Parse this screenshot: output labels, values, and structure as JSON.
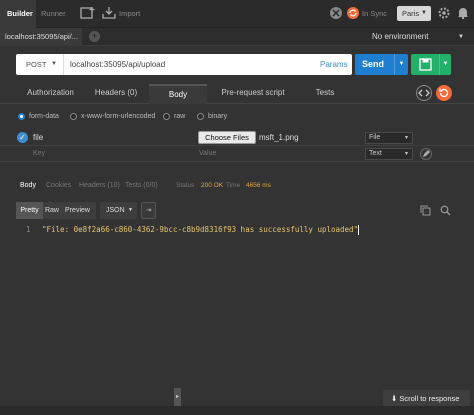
{
  "app": {
    "modes": [
      "Builder",
      "Runner"
    ],
    "import_label": "Import",
    "sync_label": "In Sync",
    "user_label": "Paris"
  },
  "tabs": {
    "request_tab": "localhost:35095/api/...",
    "environment": "No environment"
  },
  "request": {
    "method": "POST",
    "url": "localhost:35095/api/upload",
    "params_label": "Params",
    "send_label": "Send"
  },
  "request_tabs": [
    "Authorization",
    "Headers (0)",
    "Body",
    "Pre-request script",
    "Tests"
  ],
  "body_types": {
    "selected": "form-data",
    "options": [
      "form-data",
      "x-www-form-urlencoded",
      "raw",
      "binary"
    ]
  },
  "form_rows": [
    {
      "key": "file",
      "button_label": "Choose Files",
      "file_name": "msft_1.png",
      "type": "File"
    },
    {
      "key_placeholder": "Key",
      "value_placeholder": "Value",
      "type": "Text"
    }
  ],
  "response": {
    "tabs": [
      "Body",
      "Cookies",
      "Headers (10)",
      "Tests (0/0)"
    ],
    "status_label": "Status",
    "status_value": "200 OK",
    "time_label": "Time",
    "time_value": "4656 ms",
    "formats": [
      "Pretty",
      "Raw",
      "Preview"
    ],
    "language": "JSON",
    "lines": [
      {
        "no": "1",
        "text": "\"File: 0e8f2a66-c860-4362-9bcc-c8b9d8316f93 has successfully uploaded\""
      }
    ],
    "scroll_label": "Scroll to response"
  },
  "colors": {
    "send": "#1e7fd0",
    "save": "#23b06a",
    "accent": "#3e8ed0",
    "status": "#e0a940",
    "code": "#e6c56e"
  }
}
